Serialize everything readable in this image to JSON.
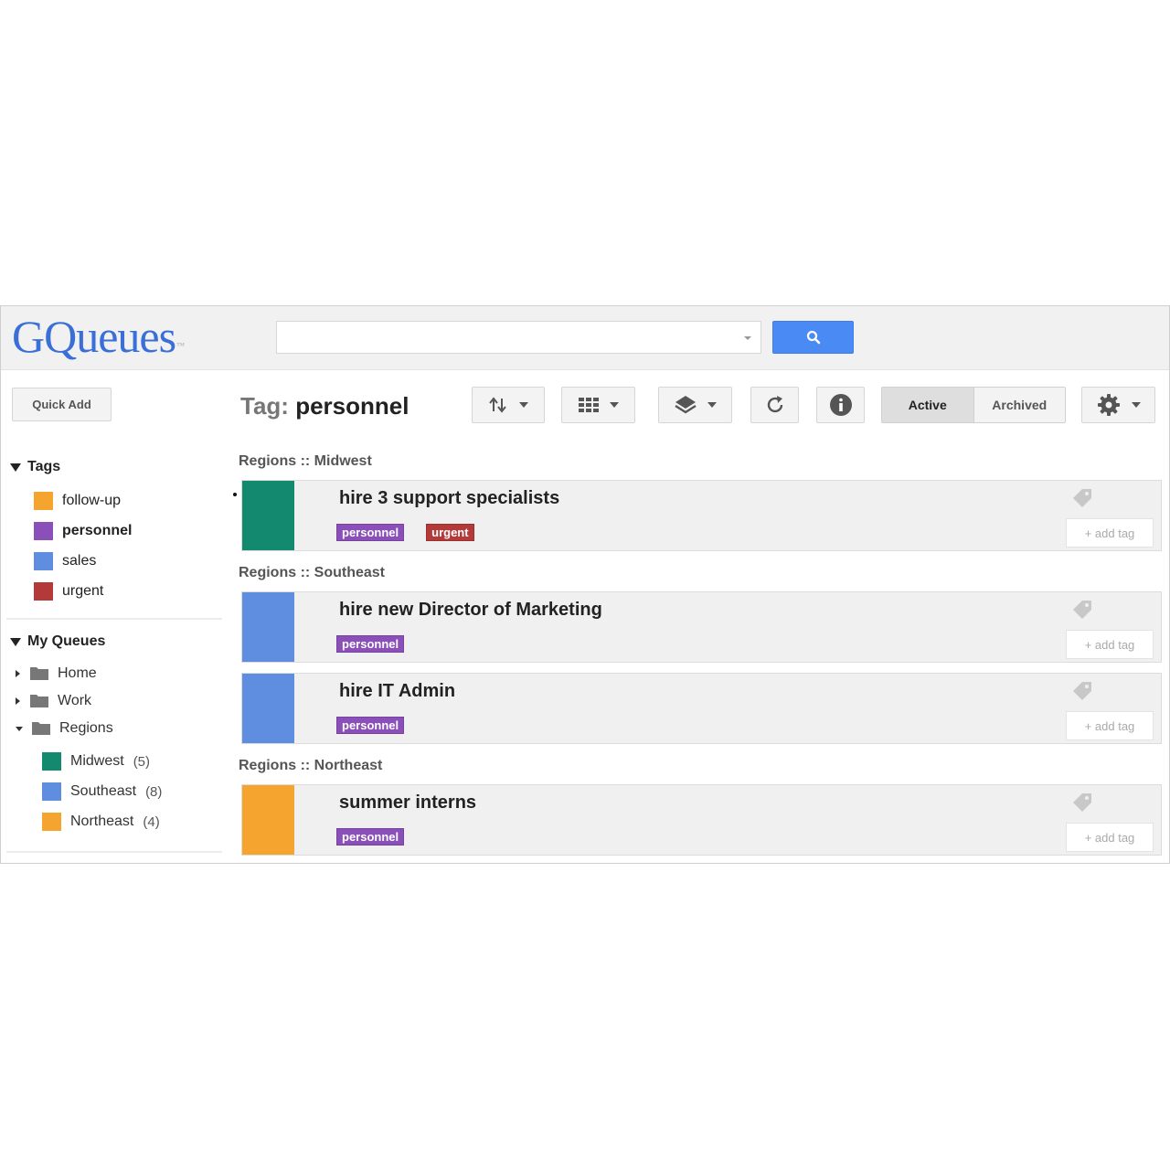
{
  "app": {
    "logo_text": "GQueues",
    "logo_tm": "™",
    "logo_colors": [
      "#3b6fd8",
      "#3b6fd8",
      "#3b6fd8",
      "#3b6fd8",
      "#3b6fd8",
      "#3b6fd8",
      "#3b6fd8"
    ]
  },
  "search": {
    "placeholder": "",
    "value": "",
    "button_color": "#4a8af4"
  },
  "toolbar": {
    "quick_add_label": "Quick Add",
    "title_prefix": "Tag:",
    "title_value": "personnel",
    "active_label": "Active",
    "archived_label": "Archived"
  },
  "sidebar": {
    "tags_heading": "Tags",
    "tags": [
      {
        "label": "follow-up",
        "color": "#f5a52f"
      },
      {
        "label": "personnel",
        "color": "#8a4fb8"
      },
      {
        "label": "sales",
        "color": "#5f8de0"
      },
      {
        "label": "urgent",
        "color": "#b43a3a"
      }
    ],
    "queues_heading": "My Queues",
    "folders": [
      {
        "label": "Home"
      },
      {
        "label": "Work"
      },
      {
        "label": "Regions"
      }
    ],
    "queues": [
      {
        "label": "Midwest",
        "count": "(5)",
        "color": "#138a70"
      },
      {
        "label": "Southeast",
        "count": "(8)",
        "color": "#5f8de0"
      },
      {
        "label": "Northeast",
        "count": "(4)",
        "color": "#f5a52f"
      }
    ]
  },
  "groups": [
    {
      "label": "Regions :: Midwest"
    },
    {
      "label": "Regions :: Southeast"
    },
    {
      "label": "Regions :: Northeast"
    }
  ],
  "items": [
    {
      "title": "hire 3 support specialists",
      "bar_color": "#138a70",
      "tags": [
        {
          "label": "personnel",
          "color": "#8a4fb8"
        },
        {
          "label": "urgent",
          "color": "#b43a3a"
        }
      ],
      "add_tag_label": "+ add tag"
    },
    {
      "title": "hire new Director of Marketing",
      "bar_color": "#5f8de0",
      "tags": [
        {
          "label": "personnel",
          "color": "#8a4fb8"
        }
      ],
      "add_tag_label": "+ add tag"
    },
    {
      "title": "hire IT Admin",
      "bar_color": "#5f8de0",
      "tags": [
        {
          "label": "personnel",
          "color": "#8a4fb8"
        }
      ],
      "add_tag_label": "+ add tag"
    },
    {
      "title": "summer interns",
      "bar_color": "#f5a52f",
      "tags": [
        {
          "label": "personnel",
          "color": "#8a4fb8"
        }
      ],
      "add_tag_label": "+ add tag"
    }
  ],
  "icons": {
    "search": "search-icon",
    "sort": "sort-icon",
    "view": "grid-view-icon",
    "layers": "layers-icon",
    "refresh": "refresh-icon",
    "info": "info-icon",
    "settings": "gear-icon",
    "folder": "folder-icon",
    "tag": "tag-icon"
  }
}
